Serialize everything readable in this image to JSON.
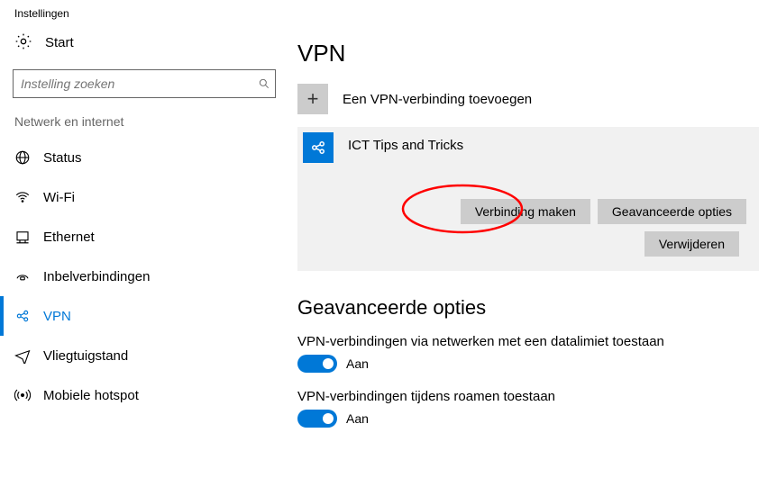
{
  "window": {
    "title": "Instellingen"
  },
  "start": {
    "label": "Start"
  },
  "search": {
    "placeholder": "Instelling zoeken"
  },
  "section": {
    "label": "Netwerk en internet"
  },
  "nav": {
    "items": [
      {
        "label": "Status"
      },
      {
        "label": "Wi-Fi"
      },
      {
        "label": "Ethernet"
      },
      {
        "label": "Inbelverbindingen"
      },
      {
        "label": "VPN",
        "active": true
      },
      {
        "label": "Vliegtuigstand"
      },
      {
        "label": "Mobiele hotspot"
      }
    ]
  },
  "main": {
    "heading": "VPN",
    "add_label": "Een VPN-verbinding toevoegen",
    "connection": {
      "name": "ICT Tips and Tricks",
      "connect": "Verbinding maken",
      "advanced": "Geavanceerde opties",
      "remove": "Verwijderen"
    },
    "adv_heading": "Geavanceerde opties",
    "toggle1": {
      "desc": "VPN-verbindingen via netwerken met een datalimiet toestaan",
      "state": "Aan"
    },
    "toggle2": {
      "desc": "VPN-verbindingen tijdens roamen toestaan",
      "state": "Aan"
    }
  }
}
